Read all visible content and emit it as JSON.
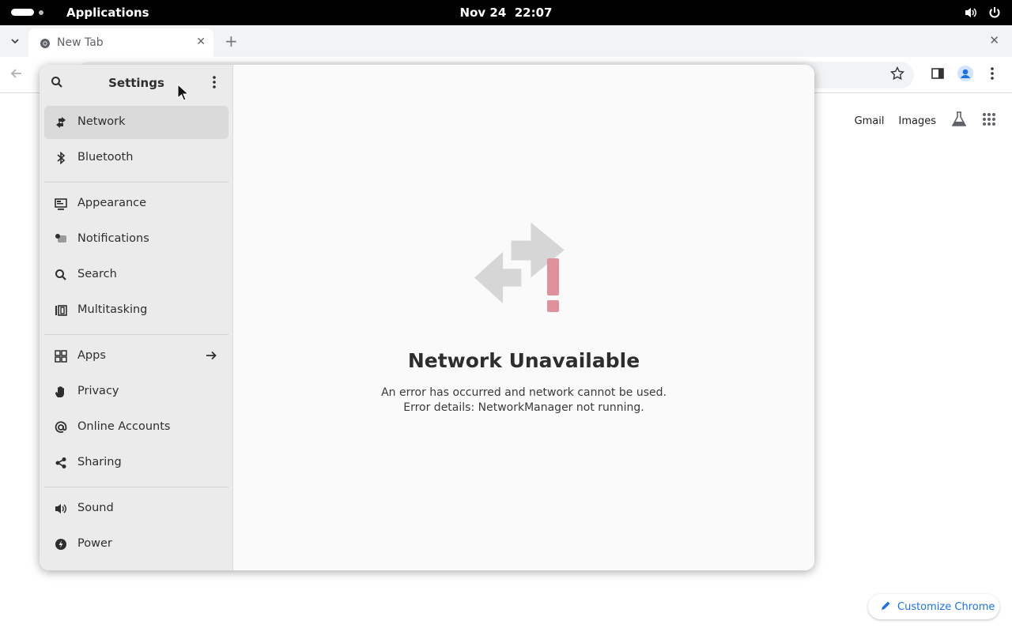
{
  "topbar": {
    "apps_label": "Applications",
    "date": "Nov 24",
    "time": "22:07",
    "icons": [
      "volume-icon",
      "power-icon"
    ]
  },
  "browser": {
    "tab_title": "New Tab",
    "ntp_links": {
      "gmail": "Gmail",
      "images": "Images"
    },
    "customize_label": "Customize Chrome",
    "accent_color": "#1a73e8"
  },
  "settings": {
    "title": "Settings",
    "sidebar": {
      "groups": [
        [
          {
            "label": "Network",
            "icon": "network-icon",
            "active": true
          },
          {
            "label": "Bluetooth",
            "icon": "bluetooth-icon"
          }
        ],
        [
          {
            "label": "Appearance",
            "icon": "appearance-icon"
          },
          {
            "label": "Notifications",
            "icon": "notifications-icon"
          },
          {
            "label": "Search",
            "icon": "search-icon"
          },
          {
            "label": "Multitasking",
            "icon": "multitasking-icon"
          }
        ],
        [
          {
            "label": "Apps",
            "icon": "apps-icon",
            "has_arrow": true
          },
          {
            "label": "Privacy",
            "icon": "privacy-icon"
          },
          {
            "label": "Online Accounts",
            "icon": "online-accounts-icon"
          },
          {
            "label": "Sharing",
            "icon": "sharing-icon"
          }
        ],
        [
          {
            "label": "Sound",
            "icon": "sound-icon"
          },
          {
            "label": "Power",
            "icon": "power-icon"
          }
        ]
      ]
    },
    "status": {
      "title": "Network Unavailable",
      "line1": "An error has occurred and network cannot be used.",
      "line2": "Error details: NetworkManager not running.",
      "icon": "network-error-icon",
      "error_color": "#e0929c"
    }
  }
}
